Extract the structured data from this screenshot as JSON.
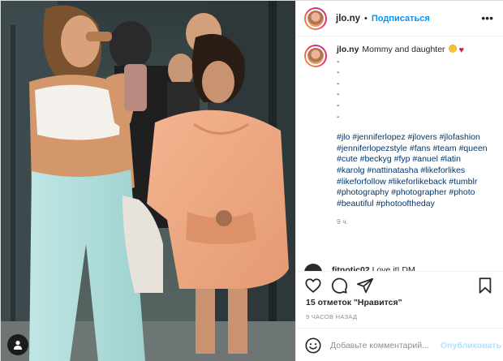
{
  "post": {
    "username": "jlo.ny",
    "follow_label": "Подписаться",
    "separator": "•",
    "more_icon": "ellipsis-icon"
  },
  "caption": {
    "username": "jlo.ny",
    "text": "Mommy and daughter",
    "emojis": [
      "heart-eyes-emoji",
      "heart-emoji"
    ],
    "dashes": [
      "-",
      "-",
      "-",
      "-",
      "-",
      "-"
    ],
    "hashtags": "#jlo #jenniferlopez #jlovers #jlofashion #jenniferlopezstyle #fans #team #queen #cute #beckyg #fyp #anuel #latin #karolg #nattinatasha #likeforlikes #likeforfollow #likeforlikeback #tumblr #photography #photographer #photo #beautiful #photooftheday",
    "time": "9 ч."
  },
  "comment_preview": {
    "username": "fitnotic02",
    "text": "Love it!",
    "badge": "DM"
  },
  "actions": {
    "like_icon": "heart-outline-icon",
    "comment_icon": "comment-icon",
    "share_icon": "paper-plane-icon",
    "save_icon": "bookmark-icon"
  },
  "likes_text": "15 отметок \"Нравится\"",
  "post_time": "9 ЧАСОВ НАЗАД",
  "comment_box": {
    "placeholder": "Добавьте комментарий...",
    "publish_label": "Опубликовать"
  },
  "colors": {
    "accent_blue": "#0095f6",
    "publish_disabled": "#b2dffc",
    "hashtag": "#00376b",
    "muted": "#8e8e8e"
  }
}
